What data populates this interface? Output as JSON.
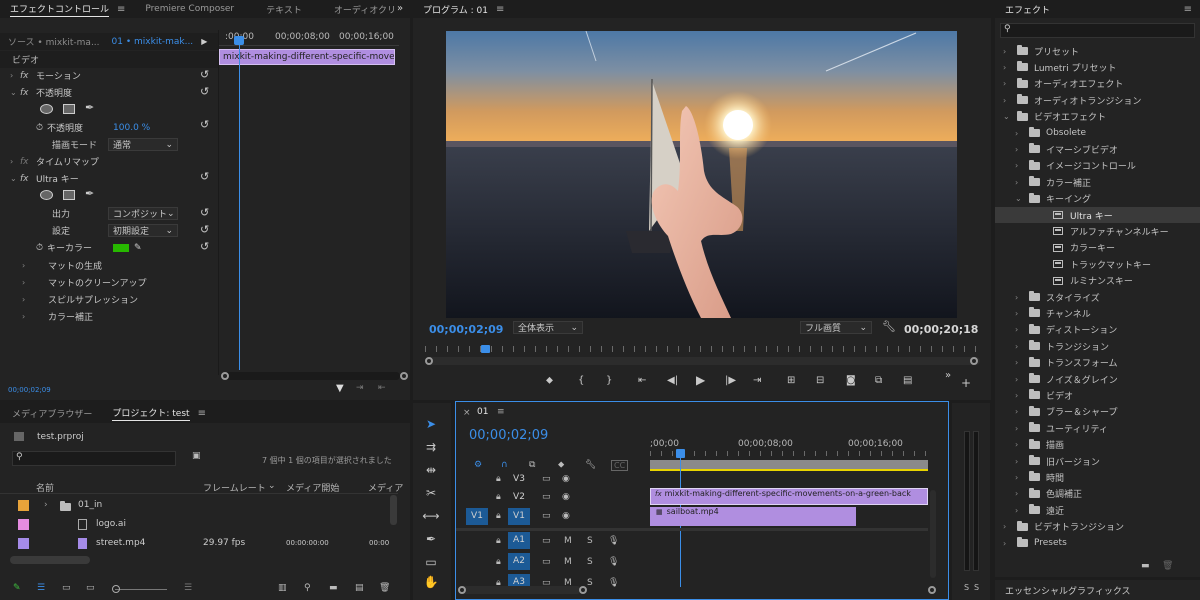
{
  "effect_controls": {
    "tabs": [
      "エフェクトコントロール",
      "Premiere Composer",
      "テキスト",
      "オーディオクリ"
    ],
    "source_label": "ソース • mixkit-ma...",
    "sequence_label": "01 • mixkit-mak...",
    "ruler_times": [
      ":00;00",
      "00;00;08;00",
      "00;00;16;00"
    ],
    "clip_name": "mixkit-making-different-specific-movemer",
    "section_video": "ビデオ",
    "motion": "モーション",
    "opacity": "不透明度",
    "opacity_prop": "不透明度",
    "opacity_value": "100.0 %",
    "blend_mode_label": "描画モード",
    "blend_mode_value": "通常",
    "time_remap": "タイムリマップ",
    "ultra_key": "Ultra キー",
    "output_label": "出力",
    "output_value": "コンポジット",
    "setting_label": "設定",
    "setting_value": "初期設定",
    "key_color_label": "キーカラー",
    "key_color": "#27b800",
    "matte_generation": "マットの生成",
    "matte_cleanup": "マットのクリーンアップ",
    "spill_suppression": "スピルサプレッション",
    "color_correction": "カラー補正",
    "timecode": "00;00;02;09"
  },
  "program": {
    "title": "プログラム : 01",
    "timecode": "00;00;02;09",
    "zoom": "全体表示",
    "quality": "フル画質",
    "duration": "00;00;20;18"
  },
  "project": {
    "tabs": [
      "メディアブラウザー",
      "プロジェクト: test"
    ],
    "file": "test.prproj",
    "status": "7 個中 1 個の項目が選択されました",
    "columns": [
      "名前",
      "フレームレート",
      "メディア開始",
      "メディア"
    ],
    "items": [
      {
        "name": "01_in",
        "color": "#e8a33a",
        "fps": "",
        "start": "",
        "end": ""
      },
      {
        "name": "logo.ai",
        "color": "#e58ce0",
        "fps": "",
        "start": "",
        "end": ""
      },
      {
        "name": "street.mp4",
        "color": "#a58be8",
        "fps": "29.97 fps",
        "start": "00:00:00:00",
        "end": "00:00"
      }
    ]
  },
  "timeline": {
    "tab": "01",
    "timecode": "00;00;02;09",
    "ruler_times": [
      ";00;00",
      "00;00;08;00",
      "00;00;16;00"
    ],
    "video_tracks": [
      "V3",
      "V2",
      "V1"
    ],
    "source_patch": "V1",
    "audio_tracks": [
      "A1",
      "A2",
      "A3"
    ],
    "clip_v2": "mixkit-making-different-specific-movements-on-a-green-back",
    "clip_v1": "sailboat.mp4",
    "m_label": "M",
    "s_label": "S"
  },
  "effects_panel": {
    "title": "エフェクト",
    "tree": [
      {
        "label": "プリセット",
        "level": 0,
        "kind": "folder-star",
        "open": false
      },
      {
        "label": "Lumetri プリセット",
        "level": 0,
        "kind": "folder-star",
        "open": false
      },
      {
        "label": "オーディオエフェクト",
        "level": 0,
        "kind": "folder",
        "open": false
      },
      {
        "label": "オーディオトランジション",
        "level": 0,
        "kind": "folder",
        "open": false
      },
      {
        "label": "ビデオエフェクト",
        "level": 0,
        "kind": "folder",
        "open": true
      },
      {
        "label": "Obsolete",
        "level": 1,
        "kind": "folder",
        "open": false
      },
      {
        "label": "イマーシブビデオ",
        "level": 1,
        "kind": "folder",
        "open": false
      },
      {
        "label": "イメージコントロール",
        "level": 1,
        "kind": "folder",
        "open": false
      },
      {
        "label": "カラー補正",
        "level": 1,
        "kind": "folder",
        "open": false
      },
      {
        "label": "キーイング",
        "level": 1,
        "kind": "folder",
        "open": true
      },
      {
        "label": "Ultra キー",
        "level": 2,
        "kind": "fx",
        "selected": true
      },
      {
        "label": "アルファチャンネルキー",
        "level": 2,
        "kind": "fx"
      },
      {
        "label": "カラーキー",
        "level": 2,
        "kind": "fx"
      },
      {
        "label": "トラックマットキー",
        "level": 2,
        "kind": "fx"
      },
      {
        "label": "ルミナンスキー",
        "level": 2,
        "kind": "fx"
      },
      {
        "label": "スタイライズ",
        "level": 1,
        "kind": "folder",
        "open": false
      },
      {
        "label": "チャンネル",
        "level": 1,
        "kind": "folder",
        "open": false
      },
      {
        "label": "ディストーション",
        "level": 1,
        "kind": "folder",
        "open": false
      },
      {
        "label": "トランジション",
        "level": 1,
        "kind": "folder",
        "open": false
      },
      {
        "label": "トランスフォーム",
        "level": 1,
        "kind": "folder",
        "open": false
      },
      {
        "label": "ノイズ＆グレイン",
        "level": 1,
        "kind": "folder",
        "open": false
      },
      {
        "label": "ビデオ",
        "level": 1,
        "kind": "folder",
        "open": false
      },
      {
        "label": "ブラー＆シャープ",
        "level": 1,
        "kind": "folder",
        "open": false
      },
      {
        "label": "ユーティリティ",
        "level": 1,
        "kind": "folder",
        "open": false
      },
      {
        "label": "描画",
        "level": 1,
        "kind": "folder",
        "open": false
      },
      {
        "label": "旧バージョン",
        "level": 1,
        "kind": "folder",
        "open": false
      },
      {
        "label": "時間",
        "level": 1,
        "kind": "folder",
        "open": false
      },
      {
        "label": "色調補正",
        "level": 1,
        "kind": "folder",
        "open": false
      },
      {
        "label": "遠近",
        "level": 1,
        "kind": "folder",
        "open": false
      },
      {
        "label": "ビデオトランジション",
        "level": 0,
        "kind": "folder",
        "open": false
      },
      {
        "label": "Presets",
        "level": 0,
        "kind": "folder",
        "open": false
      }
    ],
    "essential_graphics": "エッセンシャルグラフィックス"
  },
  "audio_meter": {
    "s_labels": [
      "S",
      "S"
    ]
  }
}
